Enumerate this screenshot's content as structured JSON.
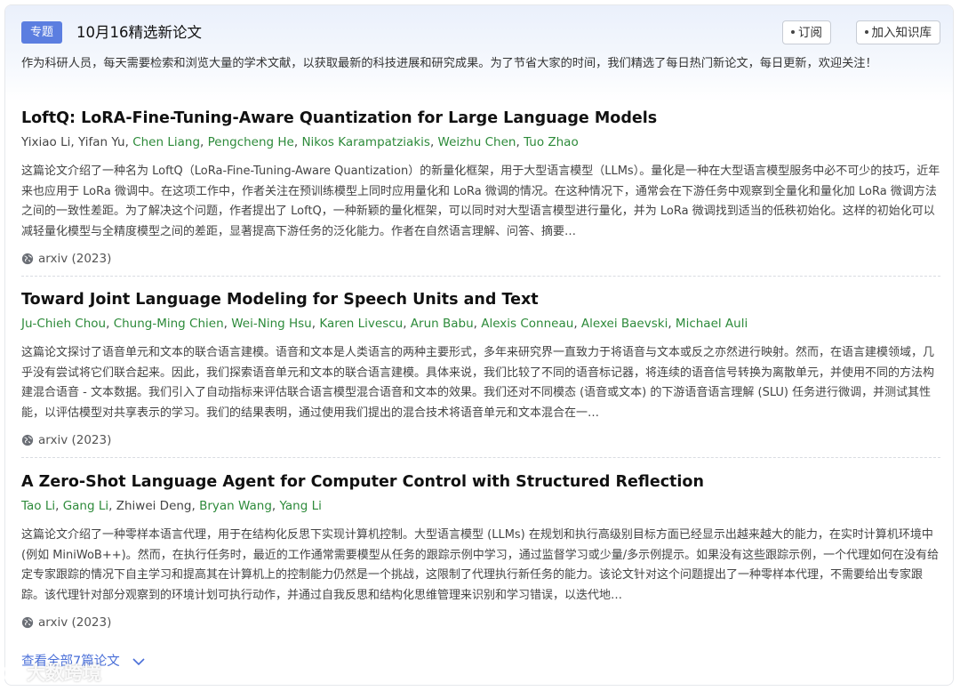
{
  "header": {
    "tag": "专题",
    "title": "10月16精选新论文",
    "subscribe_label": "订阅",
    "add_kb_label": "加入知识库"
  },
  "intro": "作为科研人员，每天需要检索和浏览大量的学术文献，以获取最新的科技进展和研究成果。为了节省大家的时间，我们精选了每日热门新论文，每日更新，欢迎关注！",
  "papers": [
    {
      "title": "LoftQ: LoRA-Fine-Tuning-Aware Quantization for Large Language Models",
      "authors": [
        {
          "name": "Yixiao Li",
          "highlight": false
        },
        {
          "name": "Yifan Yu",
          "highlight": false
        },
        {
          "name": "Chen Liang",
          "highlight": true
        },
        {
          "name": "Pengcheng He",
          "highlight": true
        },
        {
          "name": "Nikos Karampatziakis",
          "highlight": true
        },
        {
          "name": "Weizhu Chen",
          "highlight": true
        },
        {
          "name": "Tuo Zhao",
          "highlight": true
        }
      ],
      "abstract": "这篇论文介绍了一种名为 LoftQ（LoRa-Fine-Tuning-Aware Quantization）的新量化框架，用于大型语言模型（LLMs）。量化是一种在大型语言模型服务中必不可少的技巧，近年来也应用于 LoRa 微调中。在这项工作中，作者关注在预训练模型上同时应用量化和 LoRa 微调的情况。在这种情况下，通常会在下游任务中观察到全量化和量化加 LoRa 微调方法之间的一致性差距。为了解决这个问题，作者提出了 LoftQ，一种新颖的量化框架，可以同时对大型语言模型进行量化，并为 LoRa 微调找到适当的低秩初始化。这样的初始化可以减轻量化模型与全精度模型之间的差距，显著提高下游任务的泛化能力。作者在自然语言理解、问答、摘要…",
      "source": "arxiv (2023)"
    },
    {
      "title": "Toward Joint Language Modeling for Speech Units and Text",
      "authors": [
        {
          "name": "Ju-Chieh Chou",
          "highlight": true
        },
        {
          "name": "Chung-Ming Chien",
          "highlight": true
        },
        {
          "name": "Wei-Ning Hsu",
          "highlight": true
        },
        {
          "name": "Karen Livescu",
          "highlight": true
        },
        {
          "name": "Arun Babu",
          "highlight": true
        },
        {
          "name": "Alexis Conneau",
          "highlight": true
        },
        {
          "name": "Alexei Baevski",
          "highlight": true
        },
        {
          "name": "Michael Auli",
          "highlight": true
        }
      ],
      "abstract": "这篇论文探讨了语音单元和文本的联合语言建模。语音和文本是人类语言的两种主要形式，多年来研究界一直致力于将语音与文本或反之亦然进行映射。然而，在语言建模领域，几乎没有尝试将它们联合起来。因此，我们探索语音单元和文本的联合语言建模。具体来说，我们比较了不同的语音标记器，将连续的语音信号转换为离散单元，并使用不同的方法构建混合语音 - 文本数据。我们引入了自动指标来评估联合语言模型混合语音和文本的效果。我们还对不同模态 (语音或文本) 的下游语音语言理解 (SLU) 任务进行微调，并测试其性能，以评估模型对共享表示的学习。我们的结果表明，通过使用我们提出的混合技术将语音单元和文本混合在一…",
      "source": "arxiv (2023)"
    },
    {
      "title": "A Zero-Shot Language Agent for Computer Control with Structured Reflection",
      "authors": [
        {
          "name": "Tao Li",
          "highlight": true
        },
        {
          "name": "Gang Li",
          "highlight": true
        },
        {
          "name": "Zhiwei Deng",
          "highlight": false
        },
        {
          "name": "Bryan Wang",
          "highlight": true
        },
        {
          "name": "Yang Li",
          "highlight": true
        }
      ],
      "abstract": "这篇论文介绍了一种零样本语言代理，用于在结构化反思下实现计算机控制。大型语言模型 (LLMs) 在规划和执行高级别目标方面已经显示出越来越大的能力，在实时计算机环境中 (例如 MiniWoB++)。然而，在执行任务时，最近的工作通常需要模型从任务的跟踪示例中学习，通过监督学习或少量/多示例提示。如果没有这些跟踪示例，一个代理如何在没有给定专家跟踪的情况下自主学习和提高其在计算机上的控制能力仍然是一个挑战，这限制了代理执行新任务的能力。该论文针对这个问题提出了一种零样本代理，不需要给出专家跟踪。该代理针对部分观察到的环境计划可执行动作，并通过自我反思和结构化思维管理来识别和学习错误，以迭代地…",
      "source": "arxiv (2023)"
    }
  ],
  "view_all_label": "查看全部7篇论文",
  "watermark": "大数跨境",
  "colors": {
    "tag_bg": "#5b7ee0",
    "author_highlight": "#2d8a3a",
    "link": "#4a6fd8"
  },
  "icons": {
    "source": "globe-icon",
    "expand": "chevron-down-icon"
  }
}
